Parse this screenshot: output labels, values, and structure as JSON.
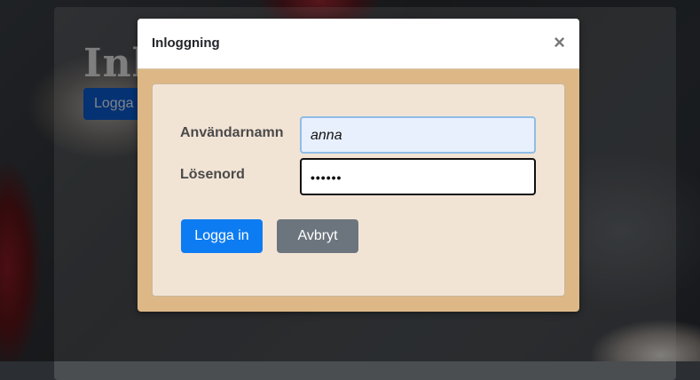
{
  "background_page": {
    "title": "Inl",
    "button_label": "Logga"
  },
  "modal": {
    "title": "Inloggning",
    "close_symbol": "×",
    "fields": {
      "username_label": "Användarnamn",
      "username_value": "anna",
      "password_label": "Lösenord",
      "password_value": "••••••"
    },
    "buttons": {
      "login": "Logga in",
      "cancel": "Avbryt"
    }
  },
  "colors": {
    "primary": "#0d7cf2",
    "secondary": "#6c757d",
    "modal_frame": "#ddb886",
    "card_bg": "#f2e4d5"
  }
}
